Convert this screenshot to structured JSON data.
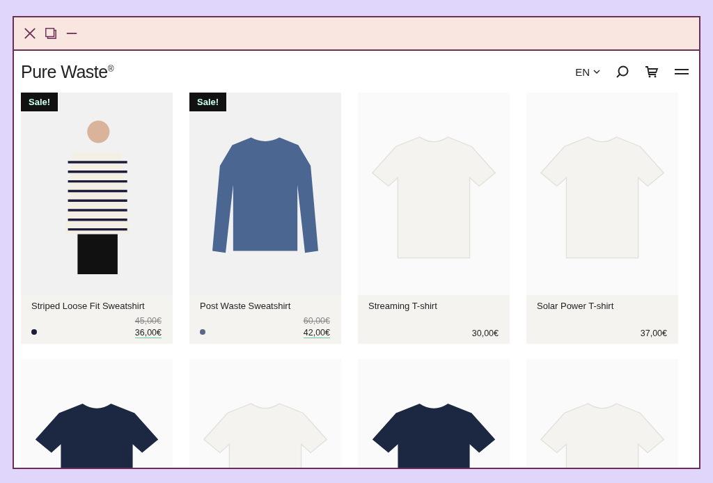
{
  "window": {
    "controls": [
      {
        "kind": "close"
      },
      {
        "kind": "restore"
      },
      {
        "kind": "minimize"
      }
    ]
  },
  "header": {
    "logo": "Pure Waste",
    "logo_mark": "®",
    "language": "EN"
  },
  "products": [
    {
      "kind": "model",
      "badge": "Sale!",
      "name": "Striped Loose Fit Sweatshirt",
      "old_price": "45,00€",
      "price": "36,00€",
      "swatch": {
        "color": "#1c1c3c"
      }
    },
    {
      "kind": "sweatshirt",
      "badge": "Sale!",
      "name": "Post Waste Sweatshirt",
      "old_price": "60,00€",
      "price": "42,00€",
      "swatch": {
        "color": "#5b6788"
      }
    },
    {
      "kind": "tshirt",
      "name": "Streaming T-shirt",
      "price": "30,00€"
    },
    {
      "kind": "tshirt",
      "name": "Solar Power T-shirt",
      "price": "37,00€"
    },
    {
      "kind": "darktshirt"
    },
    {
      "kind": "tshirt"
    },
    {
      "kind": "darktshirt"
    },
    {
      "kind": "tshirt"
    }
  ]
}
